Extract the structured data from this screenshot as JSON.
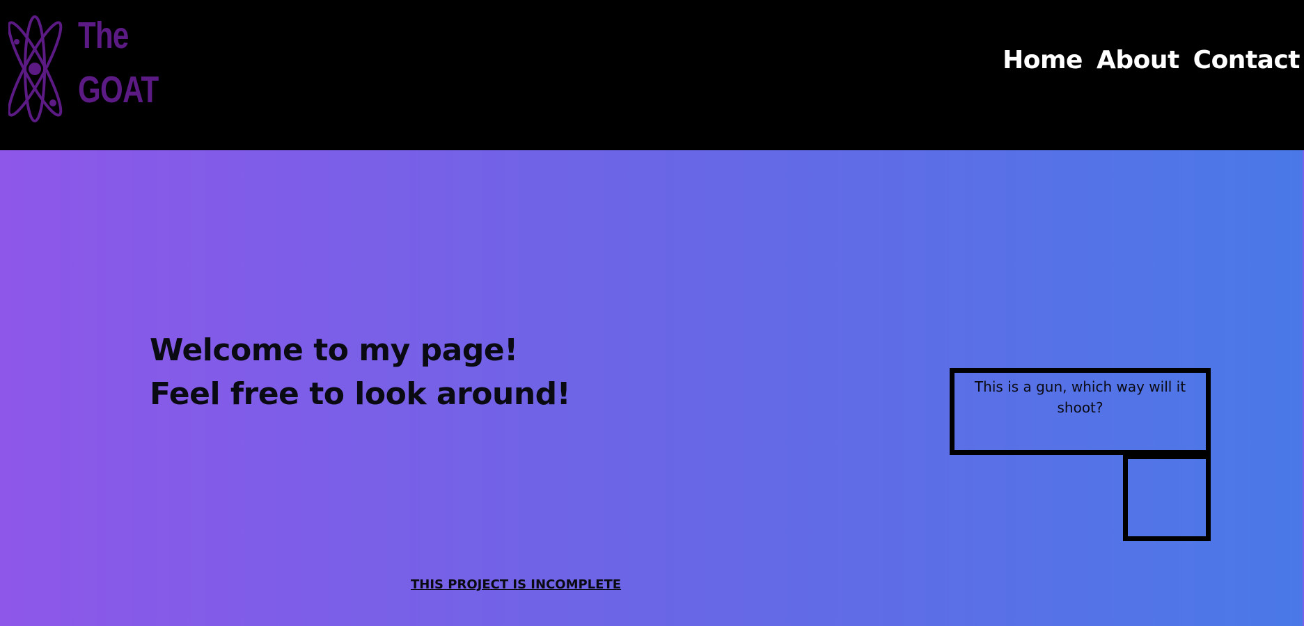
{
  "header": {
    "logo": {
      "icon": "atom-icon",
      "line1": "The",
      "line2": "GOAT",
      "color": "#5c1a85"
    },
    "nav": {
      "home": "Home",
      "about": "About",
      "contact": "Contact"
    }
  },
  "hero": {
    "welcome_line1": "Welcome to my page!",
    "welcome_line2": "Feel free to look around!",
    "gun_text": "This is a gun, which way will it shoot?",
    "incomplete_notice": "THIS PROJECT IS INCOMPLETE",
    "gradient_start": "#8e57e9",
    "gradient_end": "#4a79e7"
  }
}
